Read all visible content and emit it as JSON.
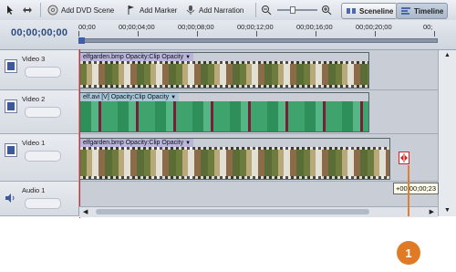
{
  "toolbar": {
    "add_dvd_scene": "Add DVD Scene",
    "add_marker": "Add Marker",
    "add_narration": "Add Narration",
    "sceneline": "Sceneline",
    "timeline": "Timeline"
  },
  "timeline": {
    "current_timecode": "00;00;00;00",
    "ruler_labels": [
      "00;00",
      "00;00;04;00",
      "00;00;08;00",
      "00;00;12;00",
      "00;00;16;00",
      "00;00;20;00",
      "00;"
    ]
  },
  "tracks": [
    {
      "name": "Video 3",
      "clip_label": "elfgarden.bmp",
      "effect_label": "Opacity:Clip Opacity"
    },
    {
      "name": "Video 2",
      "clip_label": "elf.avi [V]",
      "effect_label": "Opacity:Clip Opacity"
    },
    {
      "name": "Video 1",
      "clip_label": "elfgarden.bmp",
      "effect_label": "Opacity:Clip Opacity"
    },
    {
      "name": "Audio 1"
    }
  ],
  "tooltip": "+00;00;00;23",
  "callout_number": "1",
  "colors": {
    "playhead": "#e02828",
    "callout": "#e07a25",
    "timecode": "#2c4a80"
  }
}
